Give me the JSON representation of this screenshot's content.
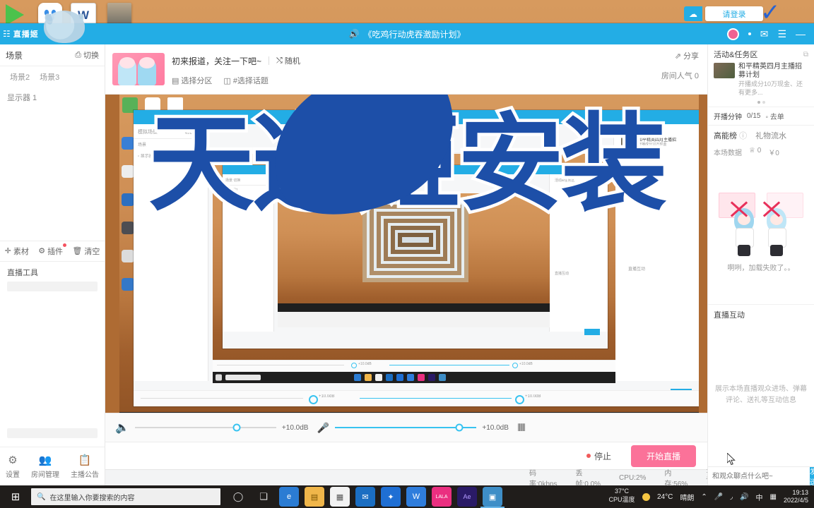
{
  "app": {
    "window_title": "《吃鸡行动虎吞激励计划》",
    "logo_text": "直播姬",
    "brand_color": "#23ade5",
    "accent_pink": "#fb7299",
    "login_button": "请登录",
    "icons": {
      "speaker": "speaker-icon",
      "avatar": "user-avatar",
      "mail": "mail-icon",
      "menu": "hamburger-menu-icon",
      "minimize": "minimize-icon"
    }
  },
  "left_panel": {
    "header_title": "场景",
    "switch_label": "切换",
    "scene_tabs": [
      "场景2",
      "场景3"
    ],
    "source_items": [
      "显示器 1"
    ],
    "tools": [
      {
        "label": "素材",
        "badge": false
      },
      {
        "label": "插件",
        "badge": true
      },
      {
        "label": "清空",
        "badge": false
      }
    ],
    "tool_section_title": "直播工具",
    "bottom_items": [
      {
        "label": "设置",
        "icon": "gear-icon"
      },
      {
        "label": "房间管理",
        "icon": "users-icon"
      },
      {
        "label": "主播公告",
        "icon": "clipboard-icon"
      }
    ]
  },
  "room": {
    "title": "初来报道，关注一下吧~",
    "random_label": "随机",
    "category_label": "选择分区",
    "topic_label": "#选择话题",
    "share_label": "分享",
    "popularity_label": "房间人气 0"
  },
  "preview": {
    "watermark_text": "天选姬安装"
  },
  "audio": {
    "speaker": {
      "icon": "speaker-icon",
      "db": "+10.0dB",
      "level_percent": 72,
      "active": false
    },
    "mic": {
      "icon": "microphone-icon",
      "db": "+10.0dB",
      "level_percent": 88,
      "active": true
    },
    "mixer_icon": "equalizer-icon"
  },
  "controls": {
    "stop_label": "停止",
    "start_live_label": "开始直播"
  },
  "status_bar": {
    "bitrate": "码率:0kbps",
    "dropped": "丢帧:0.0%",
    "cpu": "CPU:2%",
    "memory": "内存:56%",
    "more": "更多详情>"
  },
  "right_panel": {
    "activity_title": "活动&任务区",
    "activity_ad": {
      "title": "和平精英四月主播招募计划",
      "subtitle": "开播成分10万现金、还有更多..."
    },
    "broadcast_minutes_label": "开播分钟",
    "broadcast_minutes_value": "0/15",
    "task_label": "去单",
    "tabs": {
      "rank": "高能榜",
      "gifts": "礼物流水"
    },
    "session_data_label": "本场数据",
    "session_fans": "0",
    "session_income": "￥0",
    "fail_text": "啊咧，加载失败了。。",
    "interaction_title": "直播互动",
    "interaction_placeholder_text": "展示本场直播观众进场、弹幕评论、送礼等互动信息",
    "chat_input_placeholder": "和观众聊点什么吧~",
    "send_label": "发送"
  },
  "taskbar": {
    "search_placeholder": "在这里输入你要搜索的内容",
    "start_icon": "windows-start-icon",
    "cortana_icon": "circle-icon",
    "taskview_icon": "task-view-icon",
    "apps": [
      {
        "name": "edge",
        "color": "#2b7cd3",
        "glyph": "e"
      },
      {
        "name": "file-explorer",
        "color": "#f0b64a",
        "glyph": "▤"
      },
      {
        "name": "store",
        "color": "#f2f2f2",
        "glyph": "▦"
      },
      {
        "name": "mail",
        "color": "#1b6ec2",
        "glyph": "✉"
      },
      {
        "name": "bluetooth-app",
        "color": "#1f6fd4",
        "glyph": "✦"
      },
      {
        "name": "wps",
        "color": "#2f7ddc",
        "glyph": "W"
      },
      {
        "name": "lala-app",
        "color": "#ea2f80",
        "glyph": "LALA"
      },
      {
        "name": "after-effects",
        "color": "#2a1a66",
        "glyph": "Ae"
      },
      {
        "name": "live-streaming-app",
        "color": "#3e8ec7",
        "glyph": "▣"
      }
    ],
    "cpu_temp": "37°C",
    "cpu_temp_label": "CPU温度",
    "weather_temp": "24°C",
    "weather_text": "晴朗",
    "tray_icons": [
      "chevron-up-icon",
      "microphone-icon",
      "wifi-icon",
      "volume-icon",
      "ime-chinese-icon",
      "notification-icon"
    ],
    "ime_label": "中",
    "clock_time": "19:13",
    "clock_date": "2022/4/5"
  },
  "desktop_icons": [
    {
      "name": "potplayer",
      "glyph": "▶"
    },
    {
      "name": "baidu-netdisk",
      "glyph": "☁"
    },
    {
      "name": "word-document",
      "glyph": "W"
    },
    {
      "name": "image-file",
      "glyph": ""
    }
  ]
}
